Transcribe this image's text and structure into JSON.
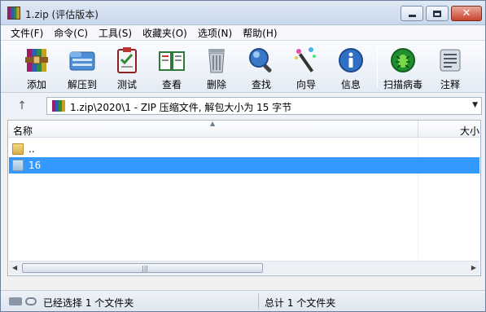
{
  "window": {
    "title": "1.zip (评估版本)"
  },
  "window_controls": {
    "minimize": "",
    "maximize": "",
    "close": "✕"
  },
  "menu": [
    "文件(F)",
    "命令(C)",
    "工具(S)",
    "收藏夹(O)",
    "选项(N)",
    "帮助(H)"
  ],
  "toolbar": [
    {
      "label": "添加",
      "icon": "add-archive-icon"
    },
    {
      "label": "解压到",
      "icon": "extract-to-icon"
    },
    {
      "label": "测试",
      "icon": "test-icon"
    },
    {
      "label": "查看",
      "icon": "view-book-icon"
    },
    {
      "label": "删除",
      "icon": "trash-icon"
    },
    {
      "label": "查找",
      "icon": "magnifier-icon"
    },
    {
      "label": "向导",
      "icon": "wizard-wand-icon"
    },
    {
      "label": "信息",
      "icon": "info-icon"
    },
    {
      "label": "扫描病毒",
      "icon": "virus-scan-icon"
    },
    {
      "label": "注释",
      "icon": "comment-icon"
    }
  ],
  "address": {
    "up_symbol": "↑",
    "path": "1.zip\\2020\\1 - ZIP 压缩文件, 解包大小为 15 字节",
    "dropdown_symbol": "▼"
  },
  "list": {
    "columns": {
      "name": "名称",
      "size": "大小"
    },
    "rows": [
      {
        "name": "..",
        "selected": false
      },
      {
        "name": "16",
        "selected": true
      }
    ]
  },
  "scrollbar": {
    "left": "◀",
    "right": "▶",
    "grip": "|||"
  },
  "status": {
    "left": "已经选择 1 个文件夹",
    "right": "总计 1 个文件夹"
  }
}
